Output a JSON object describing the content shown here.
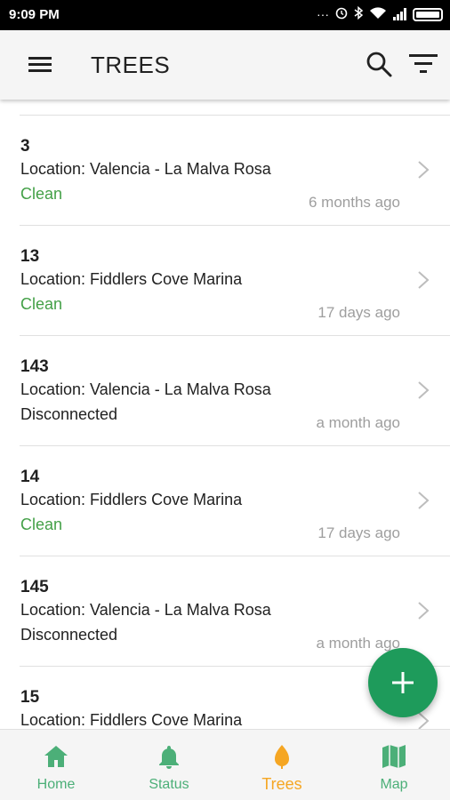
{
  "status_bar": {
    "time": "9:09 PM",
    "icons": [
      "dots-icon",
      "alarm-icon",
      "bluetooth-icon",
      "wifi-icon",
      "signal-icon",
      "battery-icon"
    ]
  },
  "app_bar": {
    "title": "TREES",
    "menu_icon": "hamburger-icon",
    "search_icon": "search-icon",
    "filter_icon": "filter-icon"
  },
  "trees": [
    {
      "id": "3",
      "location": "Location: Valencia - La Malva Rosa",
      "status": "Clean",
      "status_type": "clean",
      "time": "6 months ago"
    },
    {
      "id": "13",
      "location": "Location: Fiddlers Cove Marina",
      "status": "Clean",
      "status_type": "clean",
      "time": "17 days ago"
    },
    {
      "id": "143",
      "location": "Location: Valencia - La Malva Rosa",
      "status": "Disconnected",
      "status_type": "disconnected",
      "time": "a month ago"
    },
    {
      "id": "14",
      "location": "Location: Fiddlers Cove Marina",
      "status": "Clean",
      "status_type": "clean",
      "time": "17 days ago"
    },
    {
      "id": "145",
      "location": "Location: Valencia - La Malva Rosa",
      "status": "Disconnected",
      "status_type": "disconnected",
      "time": "a month ago"
    },
    {
      "id": "15",
      "location": "Location: Fiddlers Cove Marina",
      "status": "",
      "status_type": "clean",
      "time": ""
    }
  ],
  "fab": {
    "icon": "plus-icon",
    "color": "#1e9b5b"
  },
  "bottom_nav": [
    {
      "label": "Home",
      "icon": "home-icon",
      "active": false
    },
    {
      "label": "Status",
      "icon": "bell-icon",
      "active": false
    },
    {
      "label": "Trees",
      "icon": "leaf-icon",
      "active": true
    },
    {
      "label": "Map",
      "icon": "map-icon",
      "active": false
    }
  ],
  "colors": {
    "clean": "#43a047",
    "accent_green": "#4caf78",
    "active_orange": "#f5a623",
    "fab": "#1e9b5b"
  }
}
